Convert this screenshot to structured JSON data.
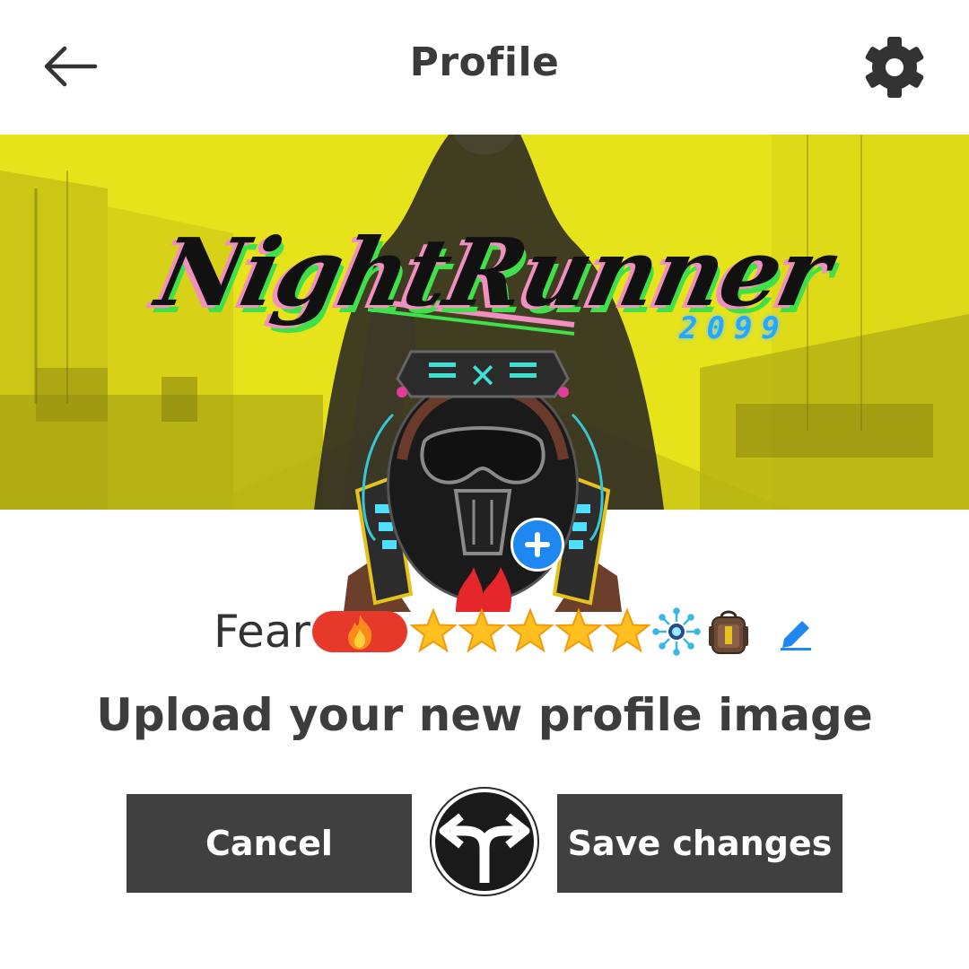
{
  "header": {
    "title": "Profile",
    "back_icon": "arrow-left-icon",
    "settings_icon": "gear-icon"
  },
  "banner": {
    "logo_title": "NightRunner",
    "logo_subtitle": "2099",
    "add_icon": "plus-circle-icon",
    "background_color": "#E8E41A"
  },
  "avatar": {
    "icon": "cyber-hood-avatar",
    "add_icon": "plus-circle-icon"
  },
  "profile": {
    "name": "Fear",
    "badges": {
      "fire_badge_icon": "fire-icon",
      "badge_color": "#E6392A",
      "stars": 5,
      "chip_icon": "circuit-eye-icon",
      "backpack_icon": "backpack-icon"
    },
    "edit_icon": "pencil-icon"
  },
  "prompt": "Upload your new profile image",
  "actions": {
    "cancel_label": "Cancel",
    "save_label": "Save changes",
    "center_icon": "split-arrows-icon"
  },
  "colors": {
    "accent_blue": "#1E88F0",
    "button_dark": "#404040",
    "text_dark": "#3D3D3D"
  }
}
